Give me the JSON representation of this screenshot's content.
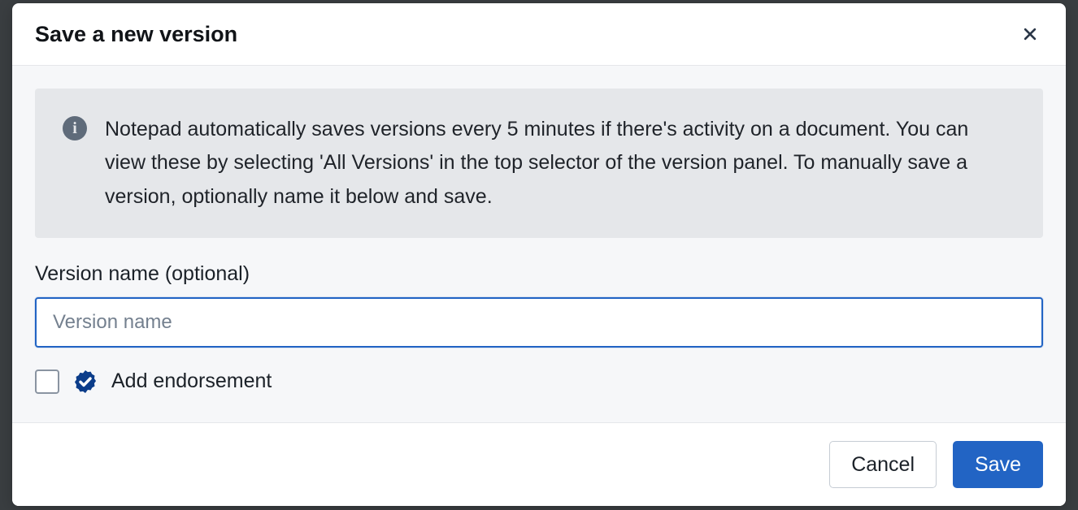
{
  "dialog": {
    "title": "Save a new version",
    "info_text": "Notepad automatically saves versions every 5 minutes if there's activity on a document. You can view these by selecting 'All Versions' in the top selector of the version panel. To manually save a version, optionally name it below and save.",
    "version_name_label": "Version name (optional)",
    "version_name_placeholder": "Version name",
    "version_name_value": "",
    "add_endorsement_label": "Add endorsement",
    "add_endorsement_checked": false,
    "cancel_label": "Cancel",
    "save_label": "Save"
  }
}
